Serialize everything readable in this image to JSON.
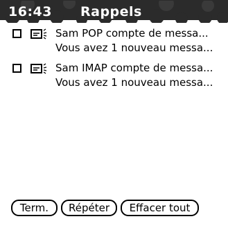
{
  "status_bar": {
    "clock": "16:43",
    "title": "Rappels"
  },
  "alarms": [
    {
      "line1": "Sam POP  compte de messa...",
      "line2": "Vous avez 1 nouveau messa...",
      "checked": false,
      "icon": "mail-alert-icon"
    },
    {
      "line1": "Sam IMAP compte de messa...",
      "line2": "Vous avez 1 nouveau messa...",
      "checked": false,
      "icon": "mail-alert-icon"
    }
  ],
  "buttons": {
    "done": "Term.",
    "snooze": "Répéter",
    "clear_all": "Effacer tout"
  },
  "colors": {
    "title_band": "#2b2b2b",
    "title_text": "#ffffff",
    "background": "#ffffff",
    "text": "#000000"
  }
}
